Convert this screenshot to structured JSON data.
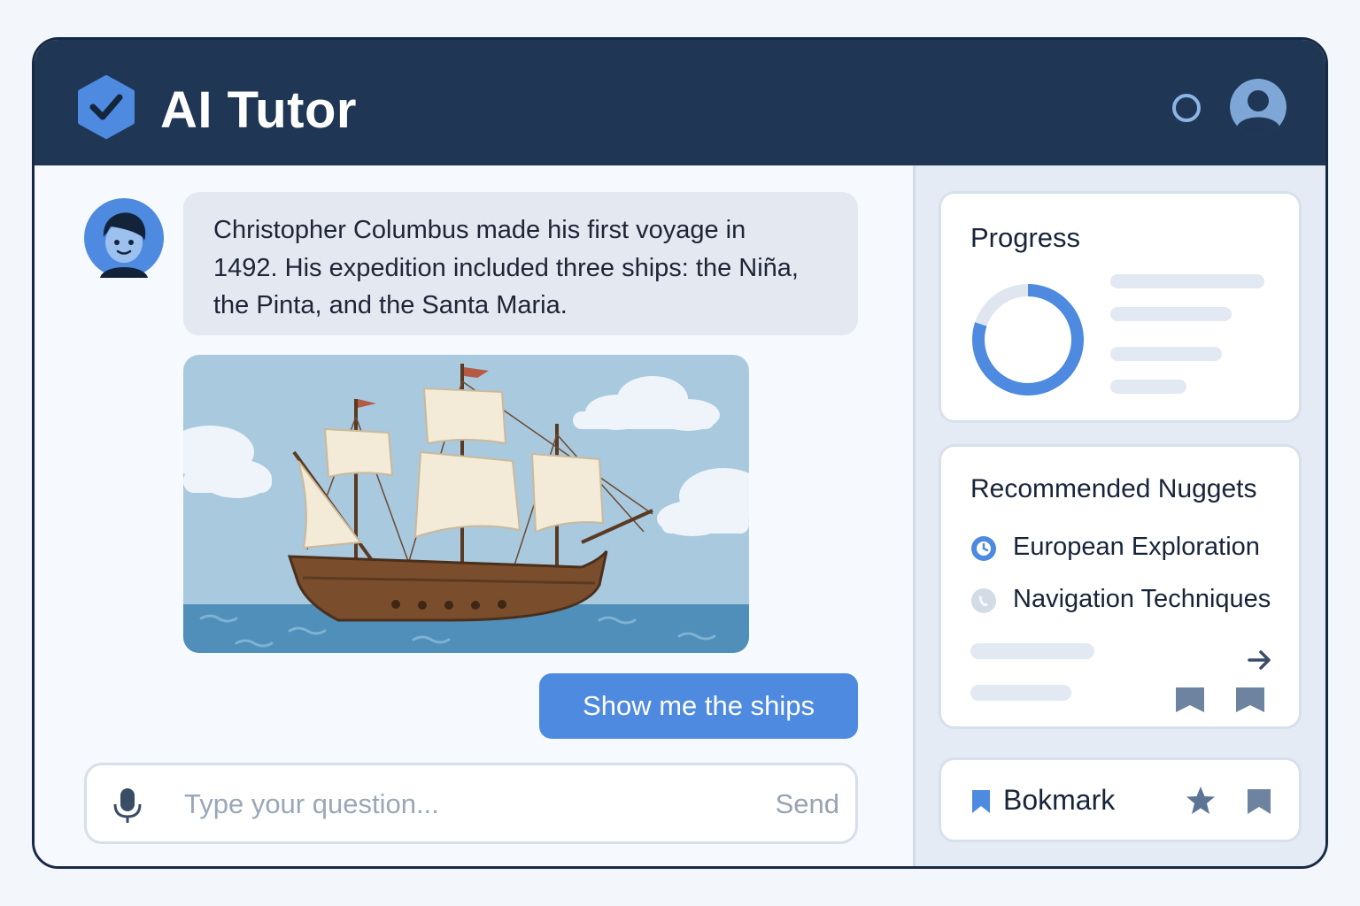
{
  "header": {
    "app_title": "AI Tutor",
    "logo_icon": "shield-check-icon",
    "status_icon": "circle-icon",
    "user_icon": "user-avatar-icon",
    "brand_color": "#1f3654",
    "accent_color": "#4d8ae0"
  },
  "chat": {
    "tutor_avatar_icon": "tutor-avatar-icon",
    "message": "Christopher Columbus made his first voyage in 1492. His expedition included three ships: the Niña, the Pinta, and the Santa Maria.",
    "message_lines": [
      "Christopher Columbus made his first voyage in",
      "1492. His expedition included three ships: the Niña,",
      "the Pinta, and the Santa Maria."
    ],
    "image_icon": "sailing-ship-illustration",
    "user_reply": "Show me the ships"
  },
  "input": {
    "mic_icon": "microphone-icon",
    "value": "",
    "placeholder": "Type your question...",
    "send_label": "Send"
  },
  "sidebar": {
    "progress": {
      "title": "Progress",
      "completion_fraction": 0.8
    },
    "nuggets": {
      "title": "Recommended Nuggets",
      "items": [
        {
          "label": "European Exploration",
          "icon": "clock-icon",
          "active": true
        },
        {
          "label": "Navigation Techniques",
          "icon": "phone-icon",
          "active": false
        }
      ],
      "next_icon": "arrow-right-icon",
      "bookmark_icons": [
        "bookmark-icon",
        "bookmark-icon"
      ]
    },
    "bookmark": {
      "label": "Bokmark",
      "flag_icon": "bookmark-icon",
      "star_icon": "star-icon",
      "save_icon": "bookmark-icon"
    }
  }
}
